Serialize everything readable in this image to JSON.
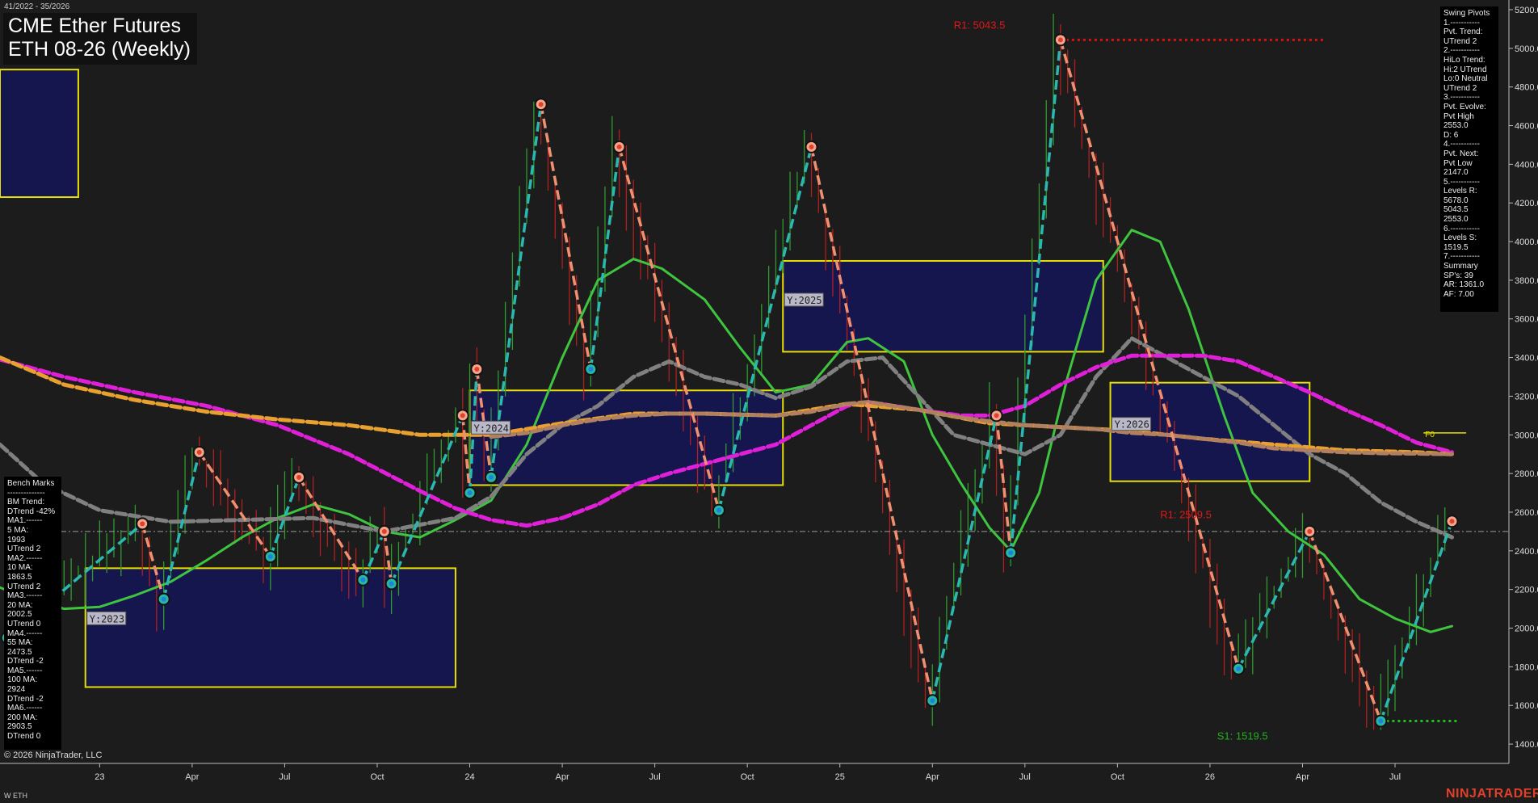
{
  "header": {
    "date_range": "41/2022 - 35/2026",
    "title": "CME Ether Futures",
    "subtitle": "ETH 08-26 (Weekly)"
  },
  "footer": {
    "copyright": "© 2026 NinjaTrader, LLC",
    "symbol": "W ETH",
    "brand": "NINJATRADER"
  },
  "bench_marks": [
    "Bench Marks",
    "--------------",
    "BM Trend:",
    "DTrend -42%",
    "MA1.------",
    "5 MA:",
    "1993",
    "UTrend 2",
    "MA2.------",
    "10 MA:",
    "1863.5",
    "UTrend 2",
    "MA3.------",
    "20 MA:",
    "2002.5",
    "UTrend 0",
    "MA4.------",
    "55 MA:",
    "2473.5",
    "DTrend -2",
    "MA5.------",
    "100 MA:",
    "2924",
    "DTrend -2",
    "MA6.------",
    "200 MA:",
    "2903.5",
    "DTrend 0"
  ],
  "swing_pivots": [
    "Swing Pivots",
    "1.-----------",
    "Pvt. Trend:",
    "UTrend 2",
    "2.-----------",
    "HiLo Trend:",
    "Hi:2 UTrend",
    "Lo:0 Neutral",
    "UTrend 2",
    "3.-----------",
    "Pvt. Evolve:",
    "Pvt High",
    "2553.0",
    "D: 6",
    "4.-----------",
    "Pvt. Next:",
    "Pvt Low",
    "2147.0",
    "5.-----------",
    "Levels R:",
    "5678.0",
    "5043.5",
    "2553.0",
    "6.-----------",
    "Levels S:",
    "1519.5",
    "7.-----------",
    "Summary",
    "SP's: 39",
    "AR: 1361.0",
    "AF: 7.00"
  ],
  "chart_data": {
    "type": "line",
    "x_tick_labels": [
      "23",
      "Apr",
      "Jul",
      "Oct",
      "24",
      "Apr",
      "Jul",
      "Oct",
      "25",
      "Apr",
      "Jul",
      "Oct",
      "26",
      "Apr",
      "Jul"
    ],
    "x_tick_index": [
      5,
      18,
      31,
      44,
      57,
      70,
      83,
      96,
      109,
      122,
      135,
      148,
      161,
      174,
      187
    ],
    "ylim": [
      1300,
      5250
    ],
    "y_ticks": [
      "1400.0",
      "1600.0",
      "1800.0",
      "2000.0",
      "2200.0",
      "2400.0",
      "2600.0",
      "2800.0",
      "3000.0",
      "3200.0",
      "3400.0",
      "3600.0",
      "3800.0",
      "4000.0",
      "4200.0",
      "4400.0",
      "4600.0",
      "4800.0",
      "5000.0",
      "5200.0"
    ],
    "x_range": [
      -9,
      203
    ],
    "current_price": 2500,
    "pivots": [
      {
        "i": -8,
        "v": 1950,
        "type": "low"
      },
      {
        "i": 11,
        "v": 2540,
        "type": "high"
      },
      {
        "i": 14,
        "v": 2150,
        "type": "low"
      },
      {
        "i": 19,
        "v": 2910,
        "type": "high"
      },
      {
        "i": 29,
        "v": 2370,
        "type": "low"
      },
      {
        "i": 33,
        "v": 2780,
        "type": "high"
      },
      {
        "i": 42,
        "v": 2250,
        "type": "low"
      },
      {
        "i": 45,
        "v": 2500,
        "type": "high"
      },
      {
        "i": 46,
        "v": 2230,
        "type": "low"
      },
      {
        "i": 56,
        "v": 3100,
        "type": "high"
      },
      {
        "i": 57,
        "v": 2700,
        "type": "low"
      },
      {
        "i": 58,
        "v": 3340,
        "type": "high"
      },
      {
        "i": 60,
        "v": 2780,
        "type": "low"
      },
      {
        "i": 67,
        "v": 4710,
        "type": "high"
      },
      {
        "i": 74,
        "v": 3340,
        "type": "low"
      },
      {
        "i": 78,
        "v": 4490,
        "type": "high"
      },
      {
        "i": 92,
        "v": 2610,
        "type": "low"
      },
      {
        "i": 105,
        "v": 4490,
        "type": "high"
      },
      {
        "i": 122,
        "v": 1625,
        "type": "low"
      },
      {
        "i": 131,
        "v": 3100,
        "type": "high"
      },
      {
        "i": 133,
        "v": 2390,
        "type": "low"
      },
      {
        "i": 140,
        "v": 5043.5,
        "type": "high"
      },
      {
        "i": 165,
        "v": 1790,
        "type": "low"
      },
      {
        "i": 175,
        "v": 2500,
        "type": "high"
      },
      {
        "i": 185,
        "v": 1519.5,
        "type": "low"
      },
      {
        "i": 195,
        "v": 2553,
        "type": "high"
      }
    ],
    "series": [
      {
        "key": "ma_green",
        "color": "#3ec43e",
        "style": "solid",
        "points": [
          [
            -9,
            2210
          ],
          [
            -5,
            2150
          ],
          [
            0,
            2100
          ],
          [
            5,
            2110
          ],
          [
            10,
            2170
          ],
          [
            15,
            2240
          ],
          [
            20,
            2350
          ],
          [
            25,
            2470
          ],
          [
            30,
            2570
          ],
          [
            35,
            2640
          ],
          [
            40,
            2590
          ],
          [
            45,
            2500
          ],
          [
            50,
            2470
          ],
          [
            55,
            2560
          ],
          [
            60,
            2660
          ],
          [
            65,
            2950
          ],
          [
            70,
            3400
          ],
          [
            75,
            3800
          ],
          [
            80,
            3910
          ],
          [
            84,
            3860
          ],
          [
            90,
            3700
          ],
          [
            95,
            3450
          ],
          [
            100,
            3220
          ],
          [
            105,
            3260
          ],
          [
            110,
            3480
          ],
          [
            113,
            3500
          ],
          [
            118,
            3380
          ],
          [
            122,
            3000
          ],
          [
            126,
            2750
          ],
          [
            130,
            2520
          ],
          [
            133,
            2400
          ],
          [
            137,
            2700
          ],
          [
            141,
            3300
          ],
          [
            145,
            3800
          ],
          [
            150,
            4060
          ],
          [
            154,
            4000
          ],
          [
            158,
            3650
          ],
          [
            163,
            3100
          ],
          [
            167,
            2700
          ],
          [
            172,
            2500
          ],
          [
            177,
            2380
          ],
          [
            182,
            2150
          ],
          [
            187,
            2050
          ],
          [
            192,
            1980
          ],
          [
            195,
            2010
          ]
        ]
      },
      {
        "key": "ma_gray",
        "color": "#808080",
        "style": "dashed",
        "points": [
          [
            -9,
            2950
          ],
          [
            -3,
            2750
          ],
          [
            5,
            2610
          ],
          [
            15,
            2550
          ],
          [
            25,
            2560
          ],
          [
            35,
            2570
          ],
          [
            45,
            2500
          ],
          [
            55,
            2570
          ],
          [
            60,
            2680
          ],
          [
            65,
            2900
          ],
          [
            70,
            3050
          ],
          [
            75,
            3150
          ],
          [
            80,
            3300
          ],
          [
            85,
            3380
          ],
          [
            90,
            3300
          ],
          [
            95,
            3260
          ],
          [
            100,
            3190
          ],
          [
            105,
            3250
          ],
          [
            110,
            3380
          ],
          [
            115,
            3400
          ],
          [
            120,
            3200
          ],
          [
            125,
            3000
          ],
          [
            130,
            2950
          ],
          [
            135,
            2900
          ],
          [
            140,
            3000
          ],
          [
            145,
            3300
          ],
          [
            150,
            3500
          ],
          [
            155,
            3400
          ],
          [
            160,
            3300
          ],
          [
            165,
            3200
          ],
          [
            170,
            3050
          ],
          [
            175,
            2900
          ],
          [
            180,
            2800
          ],
          [
            185,
            2650
          ],
          [
            190,
            2550
          ],
          [
            195,
            2470
          ]
        ]
      },
      {
        "key": "ma_magenta",
        "color": "#e020d8",
        "style": "dashed",
        "points": [
          [
            -9,
            3390
          ],
          [
            0,
            3300
          ],
          [
            10,
            3220
          ],
          [
            20,
            3150
          ],
          [
            30,
            3050
          ],
          [
            40,
            2900
          ],
          [
            50,
            2710
          ],
          [
            55,
            2620
          ],
          [
            60,
            2560
          ],
          [
            65,
            2530
          ],
          [
            70,
            2570
          ],
          [
            75,
            2640
          ],
          [
            80,
            2740
          ],
          [
            85,
            2800
          ],
          [
            90,
            2850
          ],
          [
            95,
            2900
          ],
          [
            100,
            2950
          ],
          [
            105,
            3050
          ],
          [
            110,
            3150
          ],
          [
            113,
            3170
          ],
          [
            120,
            3130
          ],
          [
            126,
            3100
          ],
          [
            130,
            3100
          ],
          [
            135,
            3150
          ],
          [
            140,
            3260
          ],
          [
            145,
            3350
          ],
          [
            150,
            3410
          ],
          [
            160,
            3410
          ],
          [
            165,
            3380
          ],
          [
            170,
            3300
          ],
          [
            175,
            3220
          ],
          [
            180,
            3130
          ],
          [
            185,
            3050
          ],
          [
            190,
            2960
          ],
          [
            195,
            2910
          ]
        ]
      },
      {
        "key": "ma_orange",
        "color": "#e8a030",
        "style": "dashed",
        "points": [
          [
            -9,
            3400
          ],
          [
            0,
            3260
          ],
          [
            10,
            3180
          ],
          [
            20,
            3120
          ],
          [
            30,
            3080
          ],
          [
            40,
            3050
          ],
          [
            50,
            3000
          ],
          [
            60,
            3000
          ],
          [
            70,
            3060
          ],
          [
            80,
            3110
          ],
          [
            90,
            3110
          ],
          [
            100,
            3100
          ],
          [
            110,
            3160
          ],
          [
            120,
            3130
          ],
          [
            130,
            3060
          ],
          [
            140,
            3040
          ],
          [
            150,
            3020
          ],
          [
            160,
            2980
          ],
          [
            170,
            2950
          ],
          [
            180,
            2920
          ],
          [
            190,
            2910
          ],
          [
            195,
            2900
          ]
        ]
      },
      {
        "key": "ma_brown",
        "color": "#b08060",
        "style": "dashed",
        "points": [
          [
            60,
            2990
          ],
          [
            65,
            3010
          ],
          [
            70,
            3050
          ],
          [
            75,
            3080
          ],
          [
            80,
            3100
          ],
          [
            85,
            3110
          ],
          [
            90,
            3110
          ],
          [
            95,
            3105
          ],
          [
            100,
            3100
          ],
          [
            105,
            3120
          ],
          [
            110,
            3160
          ],
          [
            113,
            3170
          ],
          [
            120,
            3130
          ],
          [
            126,
            3090
          ],
          [
            130,
            3070
          ],
          [
            135,
            3050
          ],
          [
            140,
            3040
          ],
          [
            145,
            3030
          ],
          [
            150,
            3010
          ],
          [
            155,
            3000
          ],
          [
            160,
            2980
          ],
          [
            165,
            2960
          ],
          [
            170,
            2930
          ],
          [
            175,
            2920
          ],
          [
            180,
            2910
          ],
          [
            185,
            2905
          ],
          [
            190,
            2903
          ],
          [
            195,
            2900
          ]
        ]
      }
    ],
    "zones": [
      {
        "label": "",
        "i0": -9,
        "i1": 2,
        "v0": 4890,
        "v1": 4230
      },
      {
        "label": "Y:2023",
        "i0": 3,
        "i1": 55,
        "v0": 2310,
        "v1": 1695
      },
      {
        "label": "Y:2024",
        "i0": 57,
        "i1": 101,
        "v0": 3230,
        "v1": 2740
      },
      {
        "label": "Y:2025",
        "i0": 101,
        "i1": 146,
        "v0": 3900,
        "v1": 3430
      },
      {
        "label": "Y:2026",
        "i0": 147,
        "i1": 175,
        "v0": 3270,
        "v1": 2760
      }
    ],
    "resistance": [
      {
        "label": "R1: 5043.5",
        "v": 5043.5,
        "i0": 140,
        "i1": 177,
        "label_i": 125
      },
      {
        "label": "R1: 2509.5",
        "v": 2509.5,
        "i0": 175,
        "i1": 175,
        "label_i": 154
      }
    ],
    "support": [
      {
        "label": "S1: 1519.5",
        "v": 1519.5,
        "i0": 185,
        "i1": 196,
        "label_i": 162
      }
    ],
    "f0_label": "F0"
  }
}
